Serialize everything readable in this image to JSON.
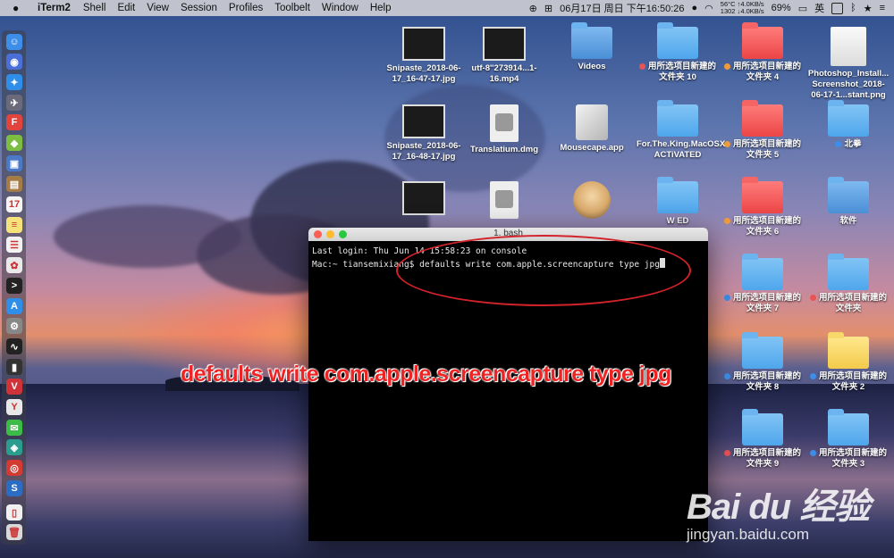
{
  "menubar": {
    "app": "iTerm2",
    "items": [
      "Shell",
      "Edit",
      "View",
      "Session",
      "Profiles",
      "Toolbelt",
      "Window",
      "Help"
    ],
    "net": {
      "temp": "56°C",
      "up": "4.0KB/s",
      "cpu": "1302",
      "down": "4.0KB/s"
    },
    "datetime": "06月17日 周日 下午16:50:26",
    "battery": "69%",
    "input_method": "英"
  },
  "dock": {
    "icons": [
      {
        "name": "finder-icon",
        "color": "#3d8ee8",
        "glyph": "☺"
      },
      {
        "name": "siri-icon",
        "color": "#4b6fd8",
        "glyph": "◉"
      },
      {
        "name": "safari-icon",
        "color": "#2f8ee8",
        "glyph": "✦"
      },
      {
        "name": "launchpad-icon",
        "color": "#6a6a7a",
        "glyph": "✈"
      },
      {
        "name": "app-red-icon",
        "color": "#e0443c",
        "glyph": "F"
      },
      {
        "name": "android-icon",
        "color": "#7dbd42",
        "glyph": "◆"
      },
      {
        "name": "preview-icon",
        "color": "#4a79c8",
        "glyph": "▣"
      },
      {
        "name": "notebook-icon",
        "color": "#a57b46",
        "glyph": "▤"
      },
      {
        "name": "calendar-icon",
        "color": "#f5f5f5",
        "glyph": "17"
      },
      {
        "name": "notes-icon",
        "color": "#f5e27a",
        "glyph": "≡"
      },
      {
        "name": "reminders-icon",
        "color": "#f2f2f2",
        "glyph": "☰"
      },
      {
        "name": "photos-icon",
        "color": "#e9e9e9",
        "glyph": "✿"
      },
      {
        "name": "terminal-icon",
        "color": "#222",
        "glyph": ">"
      },
      {
        "name": "app-store-icon",
        "color": "#2f8ee8",
        "glyph": "A"
      },
      {
        "name": "system-preferences-icon",
        "color": "#888",
        "glyph": "⚙"
      },
      {
        "name": "activity-monitor-icon",
        "color": "#222",
        "glyph": "∿"
      },
      {
        "name": "console-icon",
        "color": "#333",
        "glyph": "▮"
      },
      {
        "name": "vivaldi-icon",
        "color": "#d0323a",
        "glyph": "V"
      },
      {
        "name": "yandex-icon",
        "color": "#e8e8e8",
        "glyph": "Y"
      },
      {
        "name": "wechat-icon",
        "color": "#3dbb48",
        "glyph": "✉"
      },
      {
        "name": "app-teal-icon",
        "color": "#2a9d8f",
        "glyph": "◈"
      },
      {
        "name": "netease-music-icon",
        "color": "#d33a31",
        "glyph": "◎"
      },
      {
        "name": "scrivener-icon",
        "color": "#2b6cc4",
        "glyph": "S"
      },
      {
        "name": "document-icon",
        "color": "#f0f0f0",
        "glyph": "▯"
      },
      {
        "name": "trash-icon",
        "color": "#d8d8d8",
        "glyph": "🗑"
      }
    ]
  },
  "desktop": {
    "icons": [
      {
        "type": "thumb",
        "label": "Snipaste_2018-06-17_16-47-17.jpg",
        "dot": ""
      },
      {
        "type": "thumb",
        "label": "utf-8''273914...1-16.mp4",
        "dot": ""
      },
      {
        "type": "folder-blue",
        "label": "Videos",
        "dot": ""
      },
      {
        "type": "folder",
        "label": "用所选项目新建的文件夹 10",
        "dot": "#e85353"
      },
      {
        "type": "folder-red",
        "label": "用所选项目新建的文件夹 4",
        "dot": "#f09a3a"
      },
      {
        "type": "doc",
        "label": "Photoshop_Install... Screenshot_2018-06-17-1...stant.png",
        "dot": ""
      },
      {
        "type": "thumb",
        "label": "Snipaste_2018-06-17_16-48-17.jpg",
        "dot": ""
      },
      {
        "type": "dmg",
        "label": "Translatium.dmg",
        "dot": ""
      },
      {
        "type": "app",
        "label": "Mousecape.app",
        "dot": ""
      },
      {
        "type": "folder",
        "label": "For.The.King.MacOSX-ACTiVATED",
        "dot": ""
      },
      {
        "type": "folder-red",
        "label": "用所选项目新建的文件夹 5",
        "dot": "#f09a3a"
      },
      {
        "type": "folder",
        "label": "北拳",
        "dot": "#3d8ee8"
      },
      {
        "type": "thumb",
        "label": "",
        "dot": ""
      },
      {
        "type": "dmg",
        "label": "",
        "dot": ""
      },
      {
        "type": "avatar",
        "label": "",
        "dot": ""
      },
      {
        "type": "folder",
        "label": "W ED",
        "dot": ""
      },
      {
        "type": "folder-red",
        "label": "用所选项目新建的文件夹 6",
        "dot": "#f09a3a"
      },
      {
        "type": "folder-blue",
        "label": "软件",
        "dot": ""
      },
      {
        "type": "folder",
        "label": "用所选项目新建的文件夹 7",
        "dot": "#3d8ee8"
      },
      {
        "type": "folder",
        "label": "用所选项目新建的文件夹",
        "dot": "#e85353"
      },
      {
        "type": "folder",
        "label": "用所选项目新建的文件夹 8",
        "dot": "#3d8ee8"
      },
      {
        "type": "folder-yellow",
        "label": "用所选项目新建的文件夹 2",
        "dot": "#3d8ee8"
      },
      {
        "type": "folder",
        "label": "用所选项目新建的文件夹 9",
        "dot": "#e85353"
      },
      {
        "type": "folder",
        "label": "用所选项目新建的文件夹 3",
        "dot": "#3d8ee8"
      }
    ]
  },
  "terminal": {
    "title": "1. bash",
    "login_line": "Last login: Thu Jun 14 15:58:23 on console",
    "prompt": "Mac:~ tiansemixiang$ ",
    "command": "defaults write com.apple.screencapture type jpg"
  },
  "annotation": {
    "text": "defaults write com.apple.screencapture type jpg",
    "color": "#ee2424"
  },
  "watermark": {
    "logo": "Bai du 经验",
    "url": "jingyan.baidu.com"
  }
}
